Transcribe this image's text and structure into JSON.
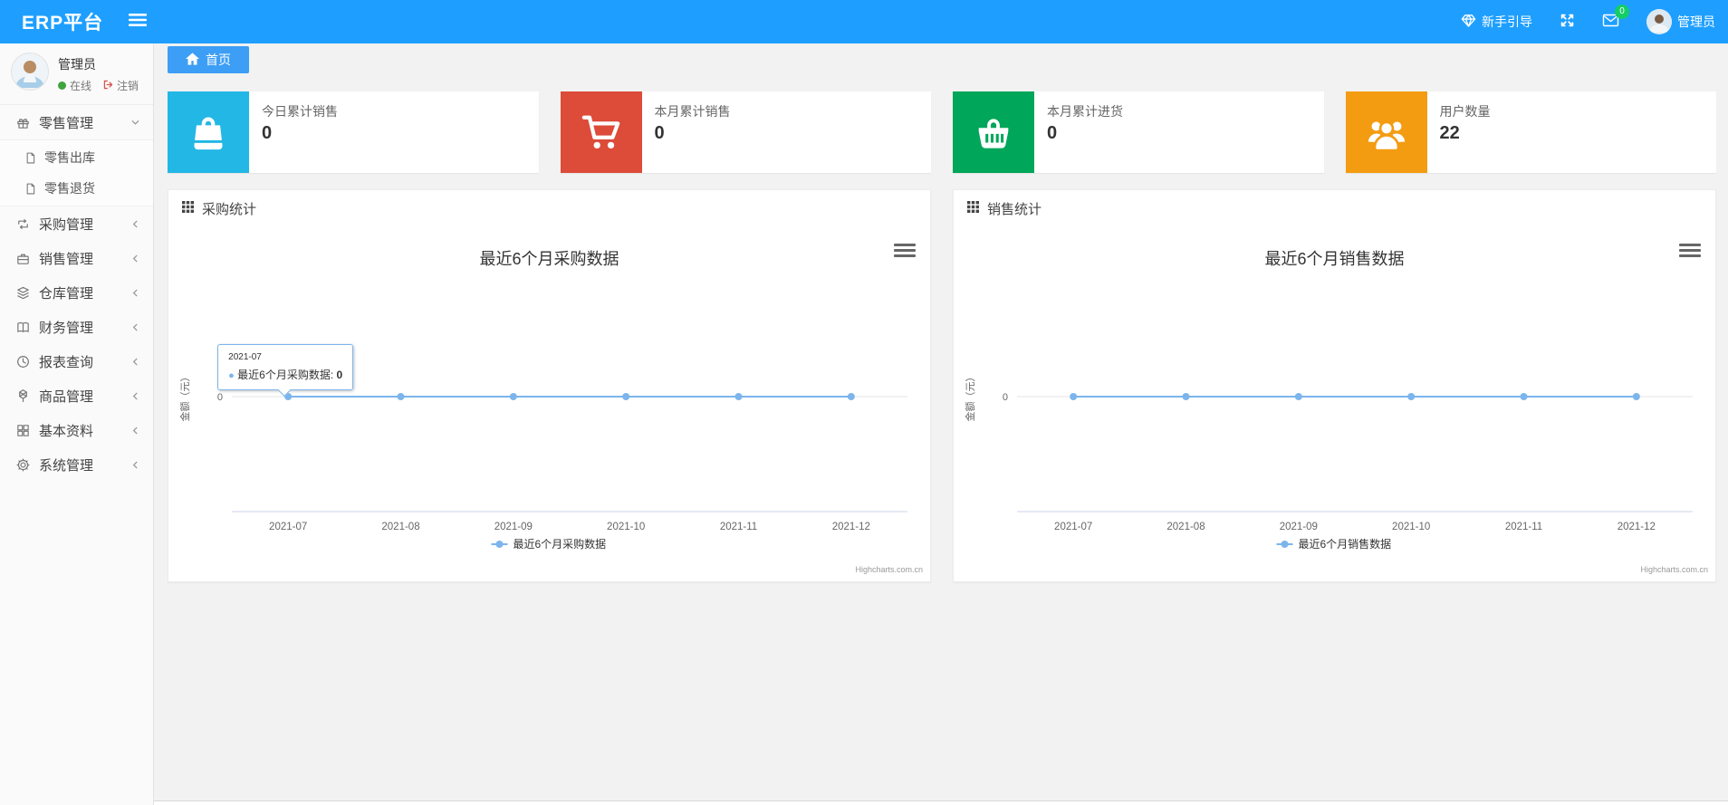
{
  "navbar": {
    "brand": "ERP平台",
    "guide_label": "新手引导",
    "badge_count": "0",
    "user_label": "管理员"
  },
  "sidebar": {
    "user": {
      "name": "管理员",
      "status": "在线",
      "logout": "注销"
    },
    "items": [
      {
        "label": "零售管理",
        "icon": "gift-icon",
        "expanded": true,
        "children": [
          {
            "label": "零售出库",
            "icon": "doc-icon"
          },
          {
            "label": "零售退货",
            "icon": "doc-icon"
          }
        ]
      },
      {
        "label": "采购管理",
        "icon": "repeat-icon",
        "expanded": false,
        "children": []
      },
      {
        "label": "销售管理",
        "icon": "briefcase-icon",
        "expanded": false,
        "children": []
      },
      {
        "label": "仓库管理",
        "icon": "layers-icon",
        "expanded": false,
        "children": []
      },
      {
        "label": "财务管理",
        "icon": "book-icon",
        "expanded": false,
        "children": []
      },
      {
        "label": "报表查询",
        "icon": "clock-icon",
        "expanded": false,
        "children": []
      },
      {
        "label": "商品管理",
        "icon": "box-icon",
        "expanded": false,
        "children": []
      },
      {
        "label": "基本资料",
        "icon": "grid-icon",
        "expanded": false,
        "children": []
      },
      {
        "label": "系统管理",
        "icon": "gear-icon",
        "expanded": false,
        "children": []
      }
    ]
  },
  "tabs": {
    "home": "首页"
  },
  "cards": [
    {
      "label": "今日累计销售",
      "value": "0",
      "color": "#23b7e5",
      "icon": "bag-icon"
    },
    {
      "label": "本月累计销售",
      "value": "0",
      "color": "#dd4b39",
      "icon": "cart-icon"
    },
    {
      "label": "本月累计进货",
      "value": "0",
      "color": "#00a65a",
      "icon": "basket-icon"
    },
    {
      "label": "用户数量",
      "value": "22",
      "color": "#f39c12",
      "icon": "users-icon"
    }
  ],
  "panels": [
    {
      "header": "采购统计"
    },
    {
      "header": "销售统计"
    }
  ],
  "chart_data": [
    {
      "type": "line",
      "title": "最近6个月采购数据",
      "categories": [
        "2021-07",
        "2021-08",
        "2021-09",
        "2021-10",
        "2021-11",
        "2021-12"
      ],
      "series": [
        {
          "name": "最近6个月采购数据",
          "values": [
            0,
            0,
            0,
            0,
            0,
            0
          ],
          "color": "#7cb5ec"
        }
      ],
      "ylabel": "金额（元）",
      "yticks": [
        "0"
      ],
      "ylim": [
        -1,
        1
      ],
      "grid": true,
      "legend_position": "bottom",
      "credit": "Highcharts.com.cn",
      "tooltip": {
        "visible": true,
        "header": "2021-07",
        "series_label": "最近6个月采购数据:",
        "value": "0",
        "point_index": 0
      }
    },
    {
      "type": "line",
      "title": "最近6个月销售数据",
      "categories": [
        "2021-07",
        "2021-08",
        "2021-09",
        "2021-10",
        "2021-11",
        "2021-12"
      ],
      "series": [
        {
          "name": "最近6个月销售数据",
          "values": [
            0,
            0,
            0,
            0,
            0,
            0
          ],
          "color": "#7cb5ec"
        }
      ],
      "ylabel": "金额（元）",
      "yticks": [
        "0"
      ],
      "ylim": [
        -1,
        1
      ],
      "grid": true,
      "legend_position": "bottom",
      "credit": "Highcharts.com.cn",
      "tooltip": {
        "visible": false
      }
    }
  ]
}
